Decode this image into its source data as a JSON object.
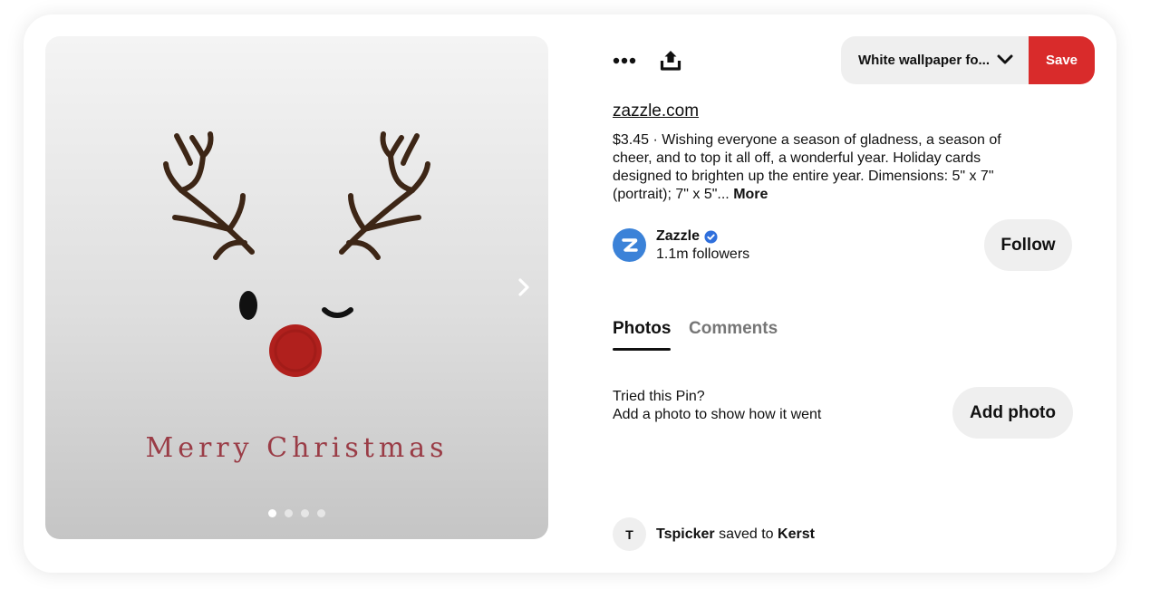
{
  "pin_image": {
    "greeting_text": "Merry Christmas",
    "carousel": {
      "total": 4,
      "active_index": 0
    },
    "colors": {
      "antlers": "#3d2616",
      "nose": "#b0201d",
      "greeting": "#9a3c46"
    },
    "icons": {
      "next": "chevron-right-icon"
    }
  },
  "toolbar": {
    "more_icon": "more-dots-icon",
    "share_icon": "share-upload-icon",
    "board_select_value": "White wallpaper fo...",
    "board_select_icon": "chevron-down-icon",
    "save_label": "Save",
    "save_color": "#d92b2b"
  },
  "pin": {
    "source": "zazzle.com",
    "description": "$3.45 · Wishing everyone a season of gladness, a season of cheer, and to top it all off, a wonderful year. Holiday cards designed to brighten up the entire year. Dimensions: 5\" x 7\" (portrait); 7\" x 5\"...",
    "more_label": "More"
  },
  "creator": {
    "name": "Zazzle",
    "avatar_letter": "Z",
    "avatar_color": "#3b82d8",
    "verified_icon": "verified-badge-icon",
    "followers": "1.1m followers",
    "follow_label": "Follow"
  },
  "tabs": [
    {
      "label": "Photos",
      "active": true
    },
    {
      "label": "Comments",
      "active": false
    }
  ],
  "tried": {
    "line1": "Tried this Pin?",
    "line2": "Add a photo to show how it went",
    "button_label": "Add photo"
  },
  "saved_by": {
    "avatar_letter": "T",
    "user": "Tspicker",
    "middle_text": "saved to",
    "board": "Kerst"
  }
}
